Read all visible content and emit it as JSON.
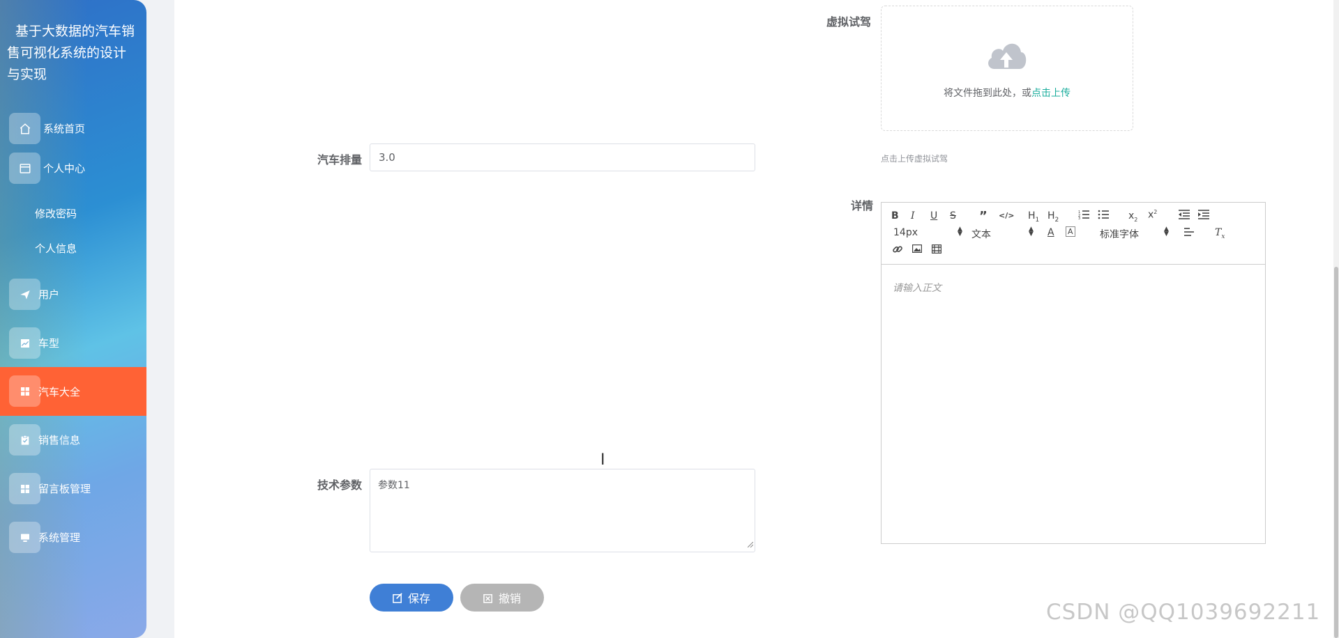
{
  "sidebar": {
    "title": "基于大数据的汽车销售可视化系统的设计与实现",
    "items": [
      {
        "label": "系统首页",
        "icon": "home-icon"
      },
      {
        "label": "个人中心",
        "icon": "card-icon"
      },
      {
        "label": "修改密码"
      },
      {
        "label": "个人信息"
      },
      {
        "label": "用户",
        "icon": "send-icon"
      },
      {
        "label": "车型",
        "icon": "chart-icon"
      },
      {
        "label": "汽车大全",
        "icon": "grid-icon",
        "active": true
      },
      {
        "label": "销售信息",
        "icon": "clipboard-icon"
      },
      {
        "label": "留言板管理",
        "icon": "grid-icon"
      },
      {
        "label": "系统管理",
        "icon": "monitor-icon"
      }
    ],
    "active_color": "#ff6235"
  },
  "form": {
    "virtual_drive": {
      "label": "虚拟试驾",
      "upload_text": "将文件拖到此处，或",
      "upload_link": "点击上传",
      "tip": "点击上传虚拟试驾"
    },
    "displacement": {
      "label": "汽车排量",
      "value": "3.0"
    },
    "details": {
      "label": "详情",
      "toolbar": {
        "font_size": "14px",
        "block": "文本",
        "font_family": "标准字体"
      },
      "placeholder": "请输入正文"
    },
    "tech_params": {
      "label": "技术参数",
      "value": "参数11"
    },
    "buttons": {
      "save": "保存",
      "cancel": "撤销"
    }
  },
  "watermark": "CSDN @QQ1039692211",
  "colors": {
    "primary": "#3f7fd6",
    "link": "#1aad9c",
    "cancel": "#b5b5b5"
  }
}
